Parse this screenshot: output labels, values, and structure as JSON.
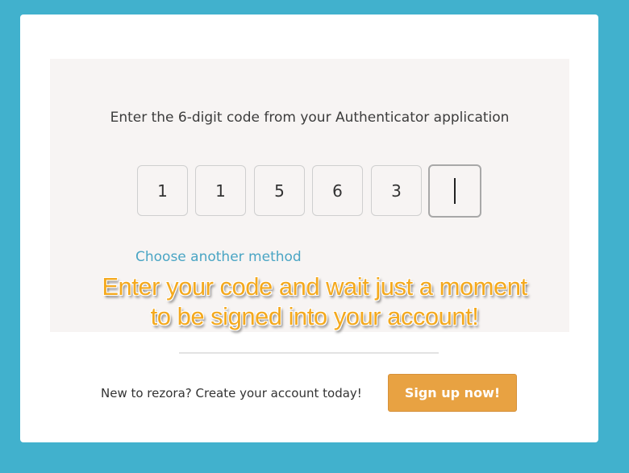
{
  "auth": {
    "instruction": "Enter the 6-digit code from your Authenticator application",
    "code_digits": [
      "1",
      "1",
      "5",
      "6",
      "3",
      ""
    ],
    "alt_method_label": "Choose another method"
  },
  "overlay": {
    "line1": "Enter your code and wait just a moment",
    "line2": "to be signed into your account!"
  },
  "signup": {
    "prompt": "New to rezora? Create your account today!",
    "button_label": "Sign up now!"
  },
  "colors": {
    "background": "#41b1cd",
    "accent_link": "#4aa5c4",
    "button": "#e8a242",
    "overlay_text": "#f4a91e"
  }
}
